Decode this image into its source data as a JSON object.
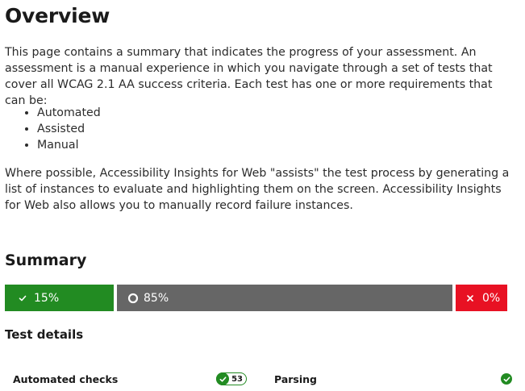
{
  "page": {
    "title": "Overview",
    "intro": "This page contains a summary that indicates the progress of your assessment. An assessment is a manual experience in which you navigate through a set of tests that cover all WCAG 2.1 AA success criteria. Each test has one or more requirements that can be:",
    "requirement_types": [
      "Automated",
      "Assisted",
      "Manual"
    ],
    "outro": "Where possible, Accessibility Insights for Web \"assists\" the test process by generating a list of instances to evaluate and highlighting them on the screen. Accessibility Insights for Web also allows you to manually record failure instances."
  },
  "summary": {
    "title": "Summary",
    "segments": {
      "pass": {
        "label": "15%",
        "fraction": 0.15,
        "icon": "checkmark-icon",
        "color": "#228b22"
      },
      "incomplete": {
        "label": "85%",
        "fraction": 0.85,
        "icon": "circle-outline-icon",
        "color": "#666666"
      },
      "fail": {
        "label": "0%",
        "fraction": 0.0,
        "icon": "cross-icon",
        "color": "#e81123"
      }
    }
  },
  "test_details": {
    "title": "Test details",
    "items": [
      {
        "name": "Automated checks",
        "status": "pass",
        "count": "53",
        "icon": "checkmark-icon"
      },
      {
        "name": "Parsing",
        "status": "pass",
        "icon": "checkmark-circle-icon"
      }
    ]
  }
}
